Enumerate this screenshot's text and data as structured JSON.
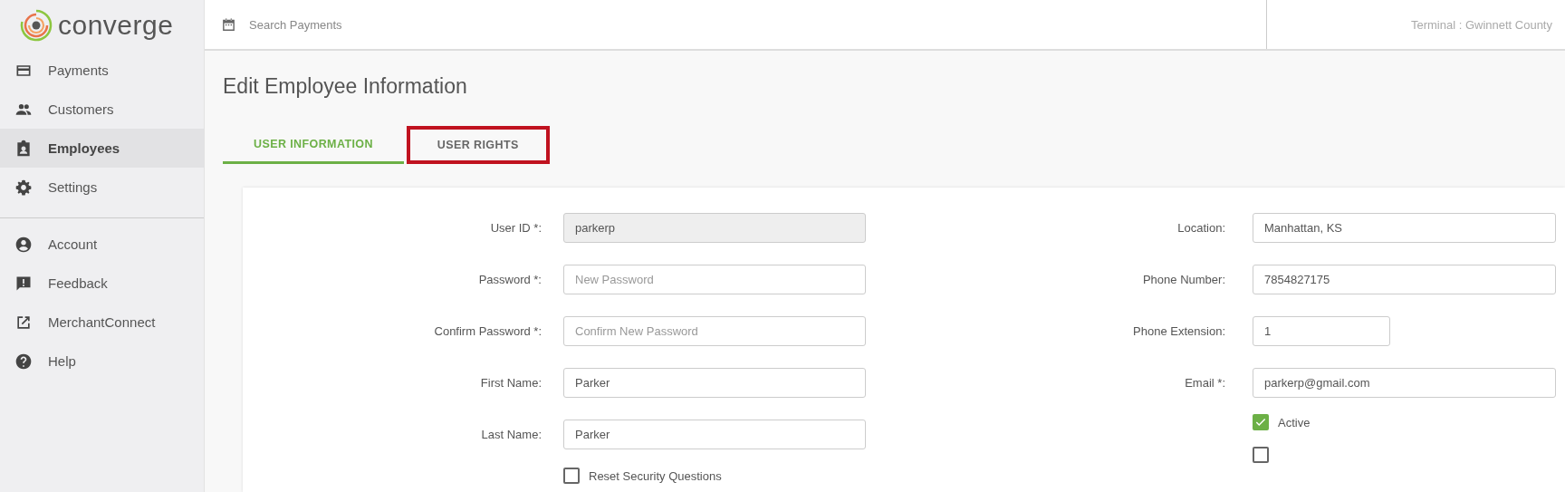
{
  "brand": {
    "name": "converge"
  },
  "sidebar": {
    "items": [
      {
        "label": "Payments",
        "selected": false
      },
      {
        "label": "Customers",
        "selected": false
      },
      {
        "label": "Employees",
        "selected": true
      },
      {
        "label": "Settings",
        "selected": false
      }
    ],
    "secondary_items": [
      {
        "label": "Account",
        "selected": false
      },
      {
        "label": "Feedback",
        "selected": false
      },
      {
        "label": "MerchantConnect",
        "selected": false
      },
      {
        "label": "Help",
        "selected": false
      }
    ]
  },
  "header": {
    "search": {
      "placeholder": "Search Payments"
    },
    "terminal": "Terminal : Gwinnett County"
  },
  "page_title": "Edit Employee Information",
  "tabs": [
    {
      "label": "USER INFORMATION",
      "selected": true,
      "highlighted": false
    },
    {
      "label": "USER RIGHTS",
      "selected": false,
      "highlighted": true
    }
  ],
  "form": {
    "left": [
      {
        "label": "User ID *:",
        "value": "parkerp",
        "disabled": true
      },
      {
        "label": "Password *:",
        "placeholder": "New Password",
        "disabled": false
      },
      {
        "label": "Confirm Password *:",
        "placeholder": "Confirm New Password",
        "disabled": false
      },
      {
        "label": "First Name:",
        "value": "Parker",
        "disabled": false
      },
      {
        "label": "Last Name:",
        "value": "Parker",
        "disabled": false
      }
    ],
    "left_checks": [
      {
        "label": "Reset Security Questions",
        "checked": false
      }
    ],
    "right": [
      {
        "label": "Location:",
        "value": "Manhattan, KS",
        "kind": "full"
      },
      {
        "label": "Phone Number:",
        "value": "7854827175",
        "kind": "full"
      },
      {
        "label": "Phone Extension:",
        "value": "1",
        "kind": "short"
      },
      {
        "label": "Email *:",
        "value": "parkerp@gmail.com",
        "kind": "full"
      }
    ],
    "right_checks": [
      {
        "label": "Active",
        "checked": true
      },
      {
        "checked": false
      }
    ]
  }
}
